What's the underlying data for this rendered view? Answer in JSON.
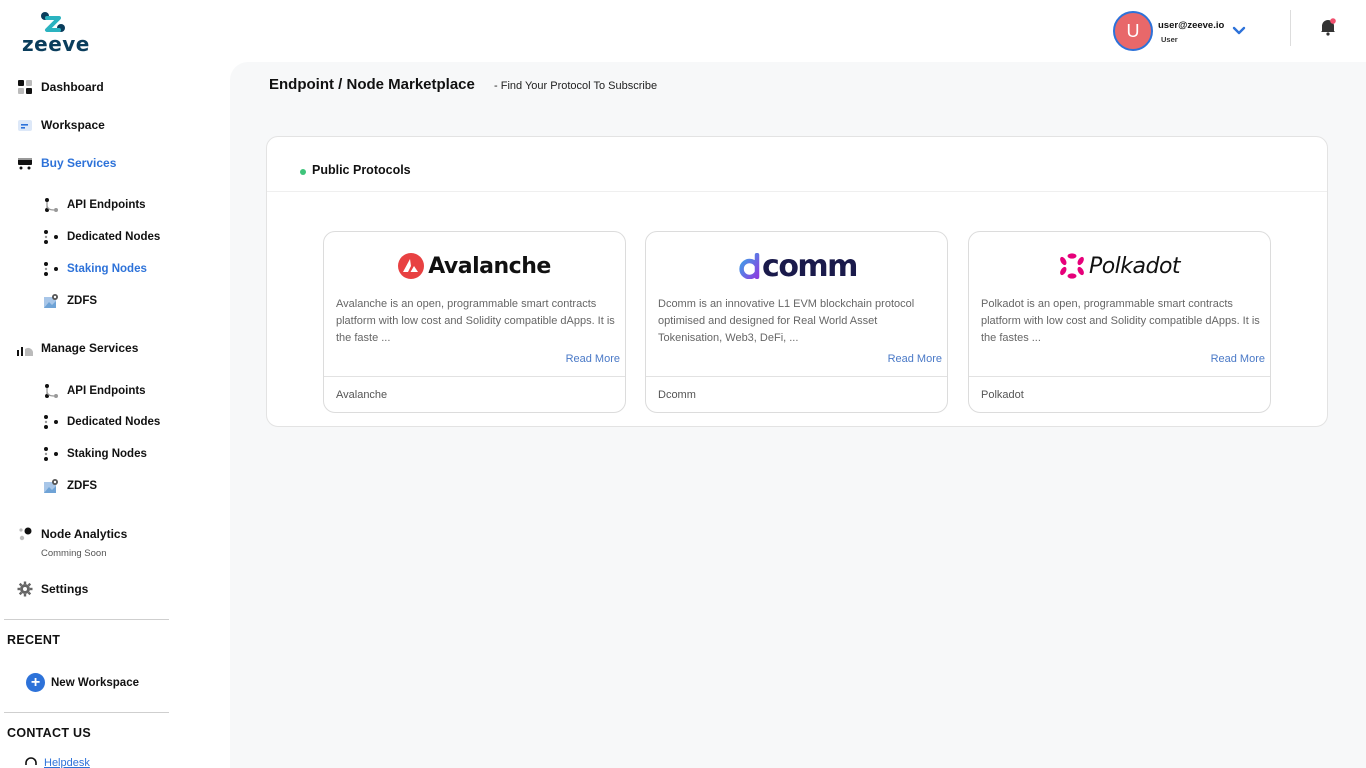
{
  "brand": {
    "name": "zeeve"
  },
  "user": {
    "initial": "U",
    "email": "user@zeeve.io",
    "role": "User"
  },
  "header": {
    "title": "Endpoint / Node Marketplace",
    "subtitle": "- Find Your Protocol To Subscribe"
  },
  "sidebar": {
    "dashboard": "Dashboard",
    "workspace": "Workspace",
    "buy_services": "Buy Services",
    "buy_items": [
      "API Endpoints",
      "Dedicated Nodes",
      "Staking Nodes",
      "ZDFS"
    ],
    "manage_services": "Manage Services",
    "manage_items": [
      "API Endpoints",
      "Dedicated Nodes",
      "Staking Nodes",
      "ZDFS"
    ],
    "node_analytics": "Node Analytics",
    "coming_soon": "Comming Soon",
    "settings": "Settings",
    "recent_heading": "RECENT",
    "new_workspace": "New Workspace",
    "contact_heading": "CONTACT US",
    "helpdesk": "Helpdesk"
  },
  "panel": {
    "title": "Public Protocols",
    "cards": [
      {
        "brand": "Avalanche",
        "description": "Avalanche is an open, programmable smart contracts platform with low cost and Solidity compatible dApps. It is the faste ...",
        "read_more": "Read More",
        "footer": "Avalanche"
      },
      {
        "brand": "comm",
        "description": "Dcomm is an innovative L1 EVM blockchain protocol optimised and designed for Real World Asset Tokenisation, Web3, DeFi, ...",
        "read_more": "Read More",
        "footer": "Dcomm"
      },
      {
        "brand": "Polkadot",
        "description": "Polkadot is an open, programmable smart contracts platform with low cost and Solidity compatible dApps. It is the fastes ...",
        "read_more": "Read More",
        "footer": "Polkadot"
      }
    ]
  },
  "colors": {
    "accent": "#2d72d9",
    "avatar": "#e8686a",
    "avalanche": "#e84142",
    "dcomm": "#7b3fe4",
    "polkadot": "#e6007a",
    "status": "#3ec47a"
  }
}
